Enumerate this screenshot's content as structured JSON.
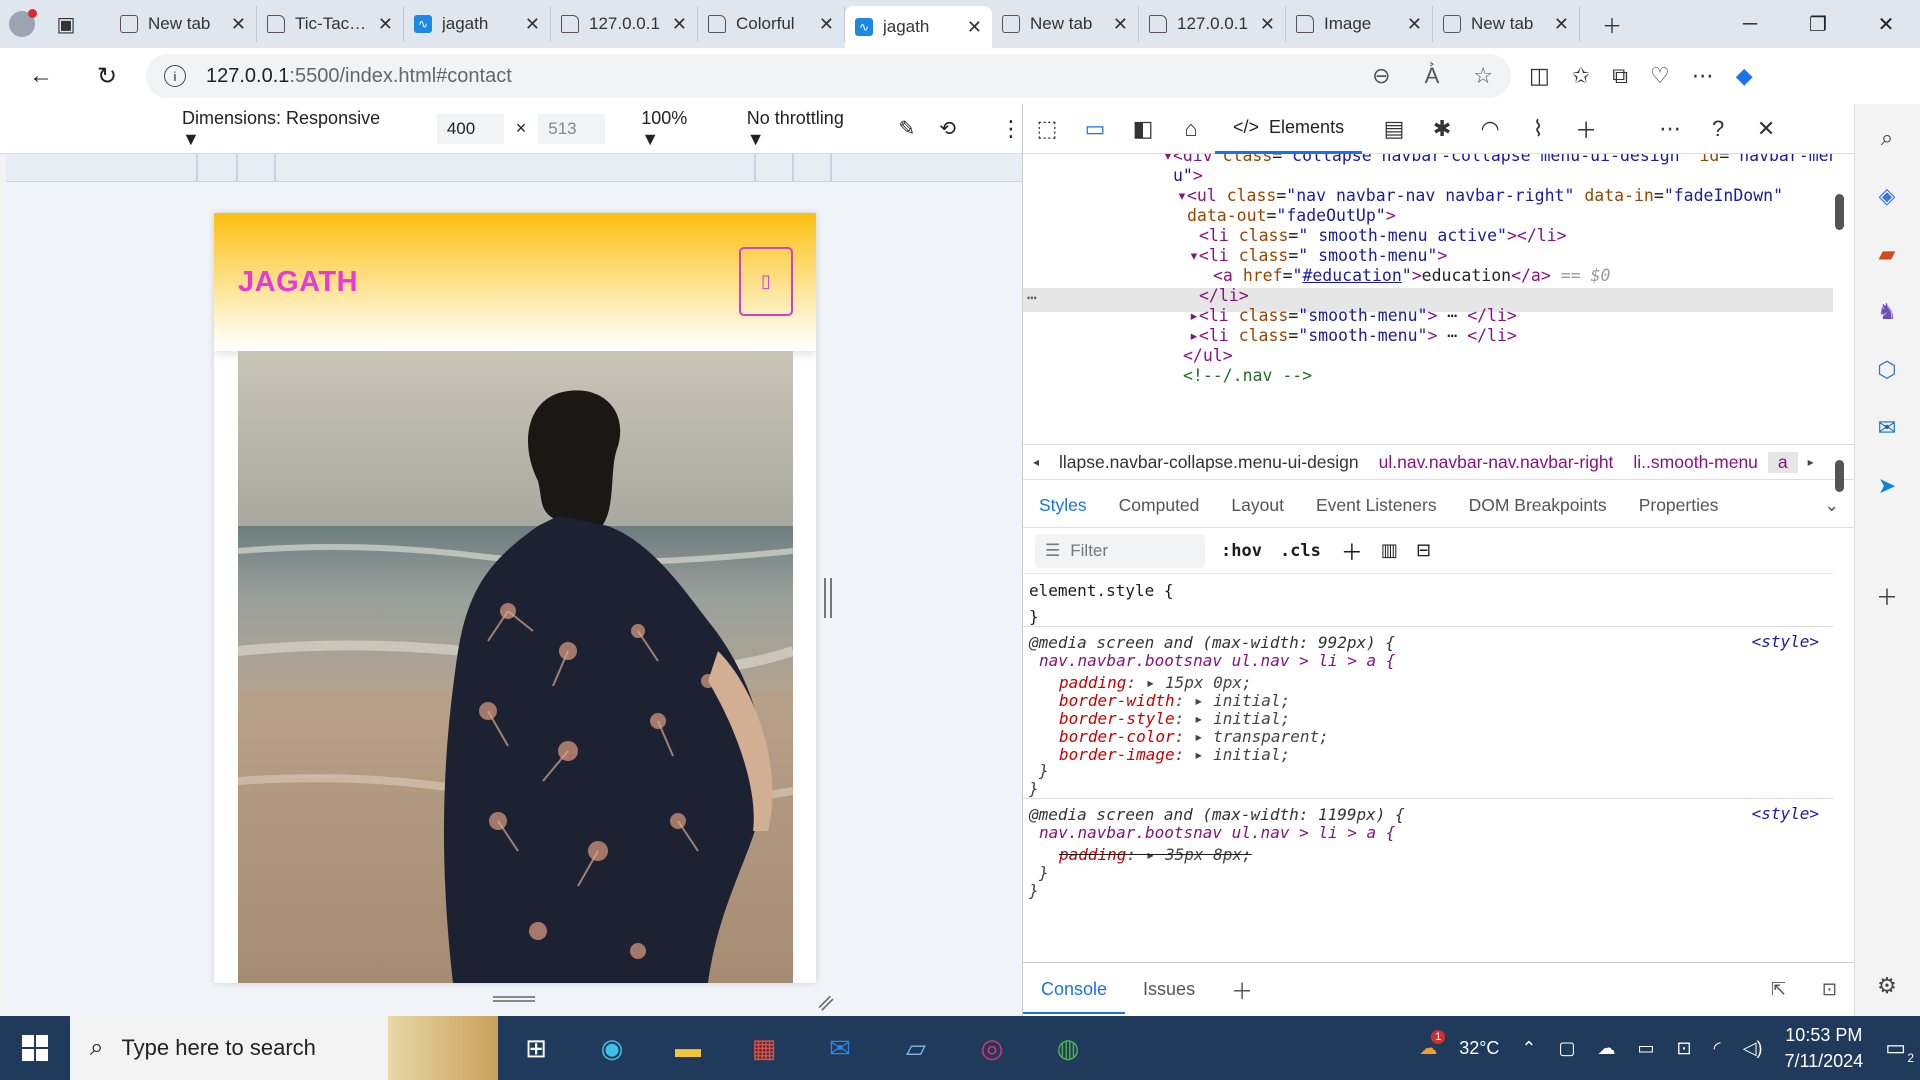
{
  "browser": {
    "tabs": [
      {
        "label": "New tab",
        "icon": "newtab-icon",
        "active": false
      },
      {
        "label": "Tic-Tac-Toe",
        "icon": "doc-icon",
        "active": false
      },
      {
        "label": "jagath",
        "icon": "vscode-live-icon",
        "active": false
      },
      {
        "label": "127.0.0.1",
        "icon": "doc-icon",
        "active": false
      },
      {
        "label": "Colorful",
        "icon": "doc-icon",
        "active": false
      },
      {
        "label": "jagath",
        "icon": "vscode-live-icon",
        "active": true
      },
      {
        "label": "New tab",
        "icon": "newtab-icon",
        "active": false
      },
      {
        "label": "127.0.0.1",
        "icon": "doc-icon",
        "active": false
      },
      {
        "label": "Image",
        "icon": "doc-icon",
        "active": false
      },
      {
        "label": "New tab",
        "icon": "newtab-icon",
        "active": false
      }
    ],
    "url_host": "127.0.0.1",
    "url_rest": ":5500/index.html#contact"
  },
  "device_toolbar": {
    "dimensions_label": "Dimensions: Responsive",
    "width": "400",
    "times": "×",
    "height": "513",
    "zoom": "100%",
    "throttling": "No throttling"
  },
  "page": {
    "brand": "JAGATH",
    "menu_glyph": "▯"
  },
  "devtools": {
    "elements_tab": "Elements",
    "code_lines": [
      {
        "html": "<span class='tg'>▾&lt;div</span> <span class='at'>class</span>=<span class='av'>\"collapse navbar-collapse menu-ui-design\"</span> <span class='at'>id</span>=<span class='av'>\"navbar-men</span>"
      },
      {
        "html": "<span class='av'>u\"</span><span class='tg'>&gt;</span>"
      },
      {
        "html": "<span class='tg'>▾&lt;ul</span> <span class='at'>class</span>=<span class='av'>\"nav navbar-nav navbar-right\"</span> <span class='at'>data-in</span>=<span class='av'>\"fadeInDown\"</span>"
      },
      {
        "html": "<span class='at'>data-out</span>=<span class='av'>\"fadeOutUp\"</span><span class='tg'>&gt;</span>"
      },
      {
        "html": "<span class='tg'>&lt;li</span> <span class='at'>class</span>=<span class='av'>\" smooth-menu active\"</span><span class='tg'>&gt;&lt;/li&gt;</span>"
      },
      {
        "html": "<span class='tg'>▾&lt;li</span> <span class='at'>class</span>=<span class='av'>\" smooth-menu\"</span><span class='tg'>&gt;</span>"
      },
      {
        "html": "<span class='tg'>&lt;a</span> <span class='at'>href</span>=<span class='av'>\"<u>#education</u>\"</span><span class='tg'>&gt;</span><span class='tx'>education</span><span class='tg'>&lt;/a&gt;</span> <span style='color:#999;font-style:italic'>== $0</span>"
      },
      {
        "html": "<span class='tg'>&lt;/li&gt;</span>"
      },
      {
        "html": "<span class='tg'>▸&lt;li</span> <span class='at'>class</span>=<span class='av'>\"smooth-menu\"</span><span class='tg'>&gt;</span> ⋯ <span class='tg'>&lt;/li&gt;</span>"
      },
      {
        "html": "<span class='tg'>▸&lt;li</span> <span class='at'>class</span>=<span class='av'>\"smooth-menu\"</span><span class='tg'>&gt;</span> ⋯ <span class='tg'>&lt;/li&gt;</span>"
      },
      {
        "html": "<span class='tg'>&lt;/ul&gt;</span>"
      },
      {
        "html": "<span class='cm'>&lt;!--/.nav --&gt;</span>"
      }
    ],
    "crumbs": [
      "llapse.navbar-collapse.menu-ui-design",
      "ul.nav.navbar-nav.navbar-right",
      "li..smooth-menu",
      "a"
    ],
    "style_tabs": [
      "Styles",
      "Computed",
      "Layout",
      "Event Listeners",
      "DOM Breakpoints",
      "Properties"
    ],
    "filter_placeholder": "Filter",
    "hov": ":hov",
    "cls": ".cls",
    "element_style": "element.style {",
    "close_brace": "}",
    "rule1_media": "@media screen and (max-width: 992px) {",
    "rule1_selector": "nav.navbar.bootsnav ul.nav > li > a {",
    "rule1_props": [
      {
        "name": "padding",
        "value": "15px 0px;"
      },
      {
        "name": "border-width",
        "value": "initial;"
      },
      {
        "name": "border-style",
        "value": "initial;"
      },
      {
        "name": "border-color",
        "value": "transparent;"
      },
      {
        "name": "border-image",
        "value": "initial;"
      }
    ],
    "rule2_media": "@media screen and (max-width: 1199px) {",
    "rule2_selector": "nav.navbar.bootsnav ul.nav > li > a {",
    "rule2_prop": {
      "name": "padding",
      "value": "35px 8px;"
    },
    "style_source": "<style>",
    "drawer_tabs": [
      "Console",
      "Issues"
    ]
  },
  "taskbar": {
    "search_placeholder": "Type here to search",
    "temperature": "32°C",
    "time": "10:53 PM",
    "date": "7/11/2024",
    "notification_count": "2",
    "weather_badge": "1"
  }
}
